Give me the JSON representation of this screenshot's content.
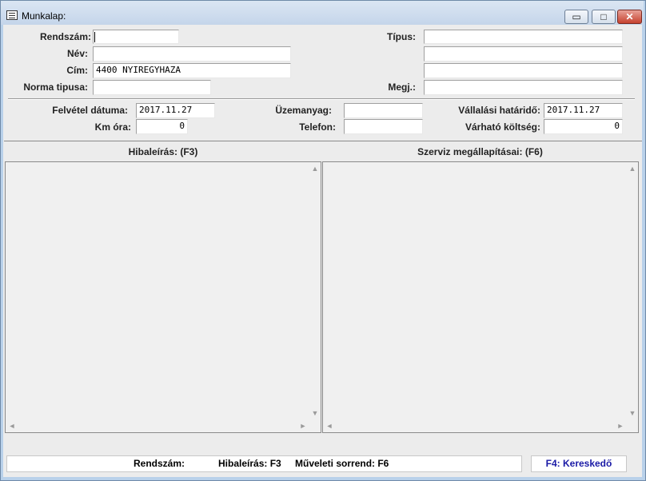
{
  "window": {
    "title": "Munkalap:"
  },
  "title_buttons": {
    "minimize": "▭",
    "maximize": "□",
    "close": "✕"
  },
  "form": {
    "rendszam": {
      "label": "Rendszám:",
      "value": ""
    },
    "nev": {
      "label": "Név:",
      "value": ""
    },
    "cim": {
      "label": "Cím:",
      "value": "4400 NYIREGYHAZA"
    },
    "norma_tipusa": {
      "label": "Norma tipusa:",
      "value": ""
    },
    "tipus": {
      "label": "Típus:",
      "value": ""
    },
    "tipus_line2": {
      "value": ""
    },
    "tipus_line3": {
      "value": ""
    },
    "megj": {
      "label": "Megj.:",
      "value": ""
    },
    "felvetel_datuma": {
      "label": "Felvétel dátuma:",
      "value": "2017.11.27"
    },
    "km_ora": {
      "label": "Km óra:",
      "value": "0"
    },
    "uzemanyag": {
      "label": "Üzemanyag:",
      "value": ""
    },
    "telefon": {
      "label": "Telefon:",
      "value": ""
    },
    "vallalasi_hatarido": {
      "label": "Vállalási határidő:",
      "value": "2017.11.27"
    },
    "varhato_koltseg": {
      "label": "Várható költség:",
      "value": "0"
    }
  },
  "panels": {
    "hibaleiras": {
      "header": "Hibaleírás:  (F3)",
      "text": ""
    },
    "szerviz": {
      "header": "Szerviz megállapításai:  (F6)",
      "text": ""
    }
  },
  "scroll": {
    "up": "▲",
    "down": "▼",
    "left": "◄",
    "right": "►"
  },
  "status": {
    "rendszam": "Rendszám:",
    "hibaleiras": "Hibaleírás: F3",
    "muveleti": "Műveleti sorrend: F6",
    "f4": "F4: Kereskedő"
  },
  "colors": {
    "status_link": "#1a1aa6",
    "frame": "#b9d1ea",
    "close_button": "#c6412e"
  }
}
